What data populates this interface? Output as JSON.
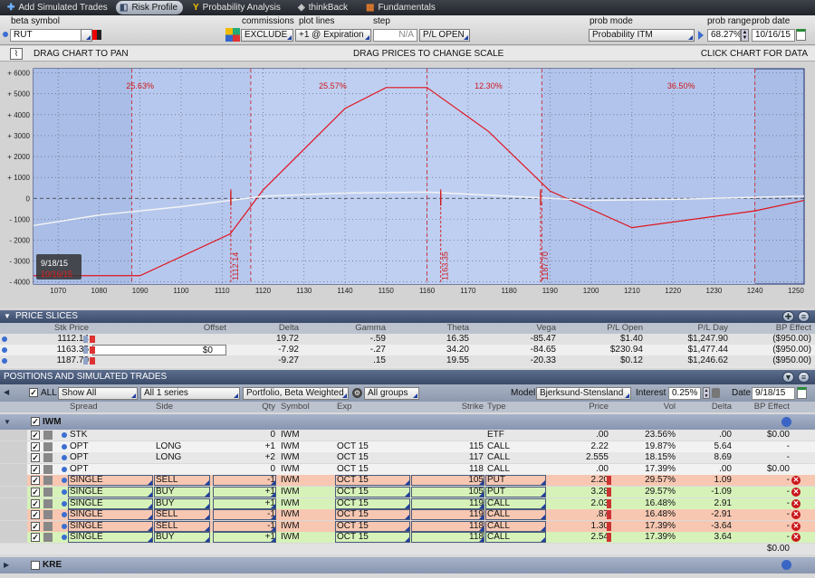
{
  "tabs": [
    {
      "label": "Add Simulated Trades",
      "icon": "plus-icon",
      "active": false
    },
    {
      "label": "Risk Profile",
      "icon": "risk-profile-icon",
      "active": true
    },
    {
      "label": "Probability Analysis",
      "icon": "probability-icon",
      "active": false
    },
    {
      "label": "thinkBack",
      "icon": "thinkback-icon",
      "active": false
    },
    {
      "label": "Fundamentals",
      "icon": "fundamentals-icon",
      "active": false
    }
  ],
  "controls": {
    "beta_symbol_label": "beta symbol",
    "beta_symbol": "RUT",
    "commissions_label": "commissions",
    "commissions": "EXCLUDE",
    "plot_lines_label": "plot lines",
    "plot_lines": "+1 @ Expiration",
    "step_label": "step",
    "step": "N/A",
    "pl_mode": "P/L OPEN",
    "prob_mode_label": "prob mode",
    "prob_mode": "Probability ITM",
    "prob_range_label": "prob range",
    "prob_range": "68.27%",
    "prob_date_label": "prob date",
    "prob_date": "10/16/15"
  },
  "chart_header": {
    "left": "DRAG CHART TO PAN",
    "center": "DRAG PRICES TO CHANGE SCALE",
    "right": "CLICK CHART FOR DATA"
  },
  "chart_data": {
    "type": "line",
    "xlim": [
      1064,
      1252
    ],
    "ylim": [
      -4100,
      6200
    ],
    "x_ticks": [
      1070,
      1080,
      1090,
      1100,
      1110,
      1120,
      1130,
      1140,
      1150,
      1160,
      1170,
      1180,
      1190,
      1200,
      1210,
      1220,
      1230,
      1240,
      1250
    ],
    "y_ticks": [
      6000,
      5000,
      4000,
      3000,
      2000,
      1000,
      0,
      -1000,
      -2000,
      -3000,
      -4000
    ],
    "y_tick_labels": [
      "+ 6000",
      "+ 5000",
      "+ 4000",
      "+ 3000",
      "+ 2000",
      "+ 1000",
      "0",
      "- 1000",
      "- 2000",
      "- 3000",
      "- 4000"
    ],
    "series": [
      {
        "color": "#e0141c",
        "points": [
          [
            1064,
            -3700
          ],
          [
            1090,
            -3700
          ],
          [
            1112,
            -1700
          ],
          [
            1120,
            400
          ],
          [
            1140,
            4300
          ],
          [
            1150,
            5300
          ],
          [
            1160,
            5300
          ],
          [
            1175,
            3200
          ],
          [
            1190,
            350
          ],
          [
            1210,
            -1400
          ],
          [
            1240,
            -600
          ],
          [
            1252,
            -100
          ]
        ]
      },
      {
        "color": "#f4f4f4",
        "points": [
          [
            1064,
            -1300
          ],
          [
            1080,
            -800
          ],
          [
            1100,
            -400
          ],
          [
            1120,
            100
          ],
          [
            1140,
            250
          ],
          [
            1160,
            300
          ],
          [
            1180,
            100
          ],
          [
            1200,
            -100
          ],
          [
            1220,
            -50
          ],
          [
            1240,
            50
          ],
          [
            1252,
            100
          ]
        ]
      }
    ],
    "price_slices": [
      1112.14,
      1163.35,
      1187.7
    ],
    "price_slice_labels": [
      "1112.14",
      "1163.35",
      "1187.70"
    ],
    "prob_regions": [
      {
        "label": "25.63%",
        "x": 1090
      },
      {
        "label": "25.57%",
        "x": 1137
      },
      {
        "label": "12.30%",
        "x": 1175
      },
      {
        "label": "36.50%",
        "x": 1222
      }
    ],
    "region_boundaries": [
      1088,
      1117,
      1160,
      1188,
      1240
    ],
    "date_label": "9/18/15",
    "date_sublabel": "10/16/15"
  },
  "price_slices": {
    "title": "PRICE SLICES",
    "columns": [
      "Stk Price",
      "Offset",
      "Delta",
      "Gamma",
      "Theta",
      "Vega",
      "P/L Open",
      "P/L Day",
      "BP Effect"
    ],
    "rows": [
      [
        "1112.14",
        "",
        "19.72",
        "-.59",
        "16.35",
        "-85.47",
        "$1.40",
        "$1,247.90",
        "($950.00)"
      ],
      [
        "1163.35",
        "$0",
        "-7.92",
        "-.27",
        "34.20",
        "-84.65",
        "$230.94",
        "$1,477.44",
        "($950.00)"
      ],
      [
        "1187.70",
        "",
        "-9.27",
        ".15",
        "19.55",
        "-20.33",
        "$0.12",
        "$1,246.62",
        "($950.00)"
      ]
    ]
  },
  "positions": {
    "title": "POSITIONS AND SIMULATED TRADES",
    "toolbar": {
      "all_label": "ALL",
      "show": "Show All",
      "series": "All 1 series",
      "weighting": "Portfolio, Beta Weighted",
      "groups": "All groups",
      "model_label": "Model",
      "model": "Bjerksund-Stensland",
      "interest_label": "Interest",
      "interest": "0.25%",
      "date_label": "Date",
      "date": "9/18/15"
    },
    "columns": [
      "Spread",
      "Side",
      "Qty",
      "Symbol",
      "Exp",
      "Strike",
      "Type",
      "Price",
      "Vol",
      "Delta",
      "BP Effect"
    ],
    "group": "IWM",
    "rows": [
      {
        "spread": "STK",
        "side": "",
        "qty": "0",
        "sym": "IWM",
        "exp": "",
        "strike": "",
        "type": "ETF",
        "price": ".00",
        "vol": "23.56%",
        "delta": ".00",
        "bp": "$0.00",
        "kind": "plain"
      },
      {
        "spread": "OPT",
        "side": "LONG",
        "qty": "+1",
        "sym": "IWM",
        "exp": "OCT 15",
        "strike": "115",
        "type": "CALL",
        "price": "2.22",
        "vol": "19.87%",
        "delta": "5.64",
        "bp": "-",
        "kind": "plain"
      },
      {
        "spread": "OPT",
        "side": "LONG",
        "qty": "+2",
        "sym": "IWM",
        "exp": "OCT 15",
        "strike": "117",
        "type": "CALL",
        "price": "2.555",
        "vol": "18.15%",
        "delta": "8.69",
        "bp": "-",
        "kind": "plain"
      },
      {
        "spread": "OPT",
        "side": "",
        "qty": "0",
        "sym": "IWM",
        "exp": "OCT 15",
        "strike": "118",
        "type": "CALL",
        "price": ".00",
        "vol": "17.39%",
        "delta": ".00",
        "bp": "$0.00",
        "kind": "plain"
      },
      {
        "spread": "SINGLE",
        "side": "SELL",
        "qty": "-1",
        "sym": "IWM",
        "exp": "OCT 15",
        "strike": "105",
        "type": "PUT",
        "price": "2.20",
        "vol": "29.57%",
        "delta": "1.09",
        "bp": "-",
        "kind": "sell"
      },
      {
        "spread": "SINGLE",
        "side": "BUY",
        "qty": "+1",
        "sym": "IWM",
        "exp": "OCT 15",
        "strike": "105",
        "type": "PUT",
        "price": "3.28",
        "vol": "29.57%",
        "delta": "-1.09",
        "bp": "-",
        "kind": "buy"
      },
      {
        "spread": "SINGLE",
        "side": "BUY",
        "qty": "+1",
        "sym": "IWM",
        "exp": "OCT 15",
        "strike": "119",
        "type": "CALL",
        "price": "2.03",
        "vol": "16.48%",
        "delta": "2.91",
        "bp": "-",
        "kind": "buy"
      },
      {
        "spread": "SINGLE",
        "side": "SELL",
        "qty": "-1",
        "sym": "IWM",
        "exp": "OCT 15",
        "strike": "119",
        "type": "CALL",
        "price": ".87",
        "vol": "16.48%",
        "delta": "-2.91",
        "bp": "-",
        "kind": "sell"
      },
      {
        "spread": "SINGLE",
        "side": "SELL",
        "qty": "-1",
        "sym": "IWM",
        "exp": "OCT 15",
        "strike": "118",
        "type": "CALL",
        "price": "1.30",
        "vol": "17.39%",
        "delta": "-3.64",
        "bp": "-",
        "kind": "sell"
      },
      {
        "spread": "SINGLE",
        "side": "BUY",
        "qty": "+1",
        "sym": "IWM",
        "exp": "OCT 15",
        "strike": "118",
        "type": "CALL",
        "price": "2.54",
        "vol": "17.39%",
        "delta": "3.64",
        "bp": "-",
        "kind": "buy"
      }
    ],
    "total_bp": "$0.00",
    "next_group": "KRE"
  }
}
